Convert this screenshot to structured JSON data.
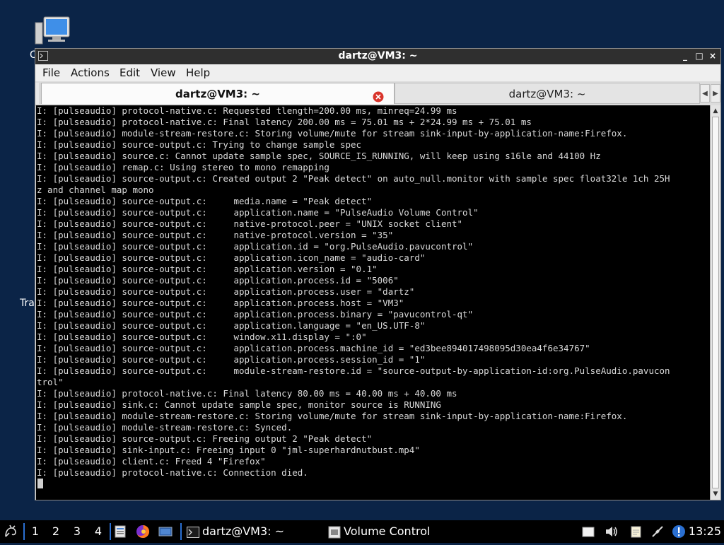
{
  "desktop": {
    "icon_label_cut_top": "C",
    "icon_label_cut_left": "Tra"
  },
  "window": {
    "title": "dartz@VM3: ~",
    "menu": [
      "File",
      "Actions",
      "Edit",
      "View",
      "Help"
    ],
    "tabs": [
      {
        "label": "dartz@VM3: ~",
        "active": true
      },
      {
        "label": "dartz@VM3: ~",
        "active": false
      }
    ],
    "controls": {
      "minimize": "_",
      "maximize": "□",
      "close": "×"
    },
    "tab_scroll_left": "◀",
    "tab_scroll_right": "▶"
  },
  "terminal": {
    "lines": [
      "I: [pulseaudio] protocol-native.c: Requested tlength=200.00 ms, minreq=24.99 ms",
      "I: [pulseaudio] protocol-native.c: Final latency 200.00 ms = 75.01 ms + 2*24.99 ms + 75.01 ms",
      "I: [pulseaudio] module-stream-restore.c: Storing volume/mute for stream sink-input-by-application-name:Firefox.",
      "I: [pulseaudio] source-output.c: Trying to change sample spec",
      "I: [pulseaudio] source.c: Cannot update sample spec, SOURCE_IS_RUNNING, will keep using s16le and 44100 Hz",
      "I: [pulseaudio] remap.c: Using stereo to mono remapping",
      "I: [pulseaudio] source-output.c: Created output 2 \"Peak detect\" on auto_null.monitor with sample spec float32le 1ch 25H",
      "z and channel map mono",
      "I: [pulseaudio] source-output.c:     media.name = \"Peak detect\"",
      "I: [pulseaudio] source-output.c:     application.name = \"PulseAudio Volume Control\"",
      "I: [pulseaudio] source-output.c:     native-protocol.peer = \"UNIX socket client\"",
      "I: [pulseaudio] source-output.c:     native-protocol.version = \"35\"",
      "I: [pulseaudio] source-output.c:     application.id = \"org.PulseAudio.pavucontrol\"",
      "I: [pulseaudio] source-output.c:     application.icon_name = \"audio-card\"",
      "I: [pulseaudio] source-output.c:     application.version = \"0.1\"",
      "I: [pulseaudio] source-output.c:     application.process.id = \"5006\"",
      "I: [pulseaudio] source-output.c:     application.process.user = \"dartz\"",
      "I: [pulseaudio] source-output.c:     application.process.host = \"VM3\"",
      "I: [pulseaudio] source-output.c:     application.process.binary = \"pavucontrol-qt\"",
      "I: [pulseaudio] source-output.c:     application.language = \"en_US.UTF-8\"",
      "I: [pulseaudio] source-output.c:     window.x11.display = \":0\"",
      "I: [pulseaudio] source-output.c:     application.process.machine_id = \"ed3bee894017498095d30ea4f6e34767\"",
      "I: [pulseaudio] source-output.c:     application.process.session_id = \"1\"",
      "I: [pulseaudio] source-output.c:     module-stream-restore.id = \"source-output-by-application-id:org.PulseAudio.pavucon",
      "trol\"",
      "I: [pulseaudio] protocol-native.c: Final latency 80.00 ms = 40.00 ms + 40.00 ms",
      "I: [pulseaudio] sink.c: Cannot update sample spec, monitor source is RUNNING",
      "I: [pulseaudio] module-stream-restore.c: Storing volume/mute for stream sink-input-by-application-name:Firefox.",
      "I: [pulseaudio] module-stream-restore.c: Synced.",
      "I: [pulseaudio] source-output.c: Freeing output 2 \"Peak detect\"",
      "I: [pulseaudio] sink-input.c: Freeing input 0 \"jml-superhardnutbust.mp4\"",
      "I: [pulseaudio] client.c: Freed 4 \"Firefox\"",
      "I: [pulseaudio] protocol-native.c: Connection died."
    ]
  },
  "taskbar": {
    "workspaces": [
      "1",
      "2",
      "3",
      "4"
    ],
    "tasks": [
      {
        "label": "dartz@VM3: ~",
        "icon": "terminal-icon"
      },
      {
        "label": "Volume Control",
        "icon": "volume-control-icon"
      }
    ],
    "clock": "13:25"
  }
}
